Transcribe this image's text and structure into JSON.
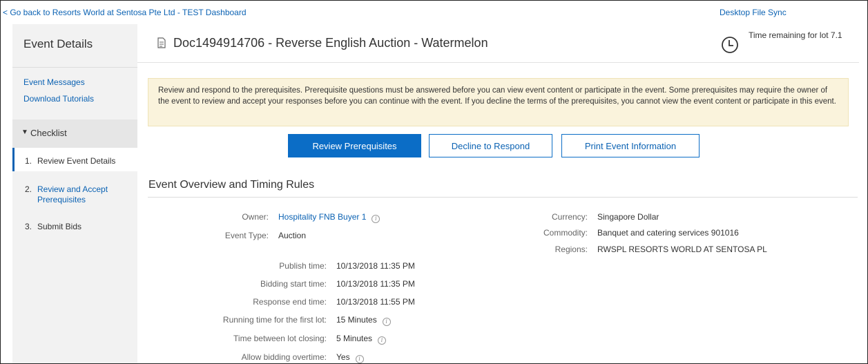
{
  "topbar": {
    "back_link": "< Go back to Resorts World at Sentosa Pte Ltd - TEST Dashboard",
    "desktop_sync": "Desktop File Sync"
  },
  "sidebar": {
    "title": "Event Details",
    "links": [
      "Event Messages",
      "Download Tutorials"
    ],
    "checklist_label": "Checklist",
    "steps": [
      {
        "num": "1.",
        "label": "Review Event Details"
      },
      {
        "num": "2.",
        "label": "Review and Accept Prerequisites"
      },
      {
        "num": "3.",
        "label": "Submit Bids"
      }
    ]
  },
  "header": {
    "title": "Doc1494914706 - Reverse English Auction - Watermelon",
    "time_remaining": "Time remaining for lot 7.1"
  },
  "notice": "Review and respond to the prerequisites. Prerequisite questions must be answered before you can view event content or participate in the event. Some prerequisites may require the owner of the event to review and accept your responses before you can continue with the event. If you decline the terms of the prerequisites, you cannot view the event content or participate in this event.",
  "buttons": {
    "review": "Review Prerequisites",
    "decline": "Decline to Respond",
    "print": "Print Event Information"
  },
  "overview": {
    "title": "Event Overview and Timing Rules",
    "owner_label": "Owner:",
    "owner": "Hospitality FNB Buyer 1",
    "event_type_label": "Event Type:",
    "event_type": "Auction",
    "currency_label": "Currency:",
    "currency": "Singapore Dollar",
    "commodity_label": "Commodity:",
    "commodity": "Banquet and catering services 901016",
    "regions_label": "Regions:",
    "regions": "RWSPL RESORTS WORLD AT SENTOSA PL",
    "publish_label": "Publish time:",
    "publish": "10/13/2018 11:35 PM",
    "start_label": "Bidding start time:",
    "start": "10/13/2018 11:35 PM",
    "end_label": "Response end time:",
    "end": "10/13/2018 11:55 PM",
    "running_label": "Running time for the first lot:",
    "running": "15 Minutes",
    "between_label": "Time between lot closing:",
    "between": "5 Minutes",
    "overtime_label": "Allow bidding overtime:",
    "overtime": "Yes"
  },
  "icons": {
    "info": "i"
  },
  "colors": {
    "accent": "#0b6dc6",
    "link": "#0b62b3",
    "notice_bg": "#faf3dc",
    "sidebar_bg": "#f2f2f2"
  }
}
